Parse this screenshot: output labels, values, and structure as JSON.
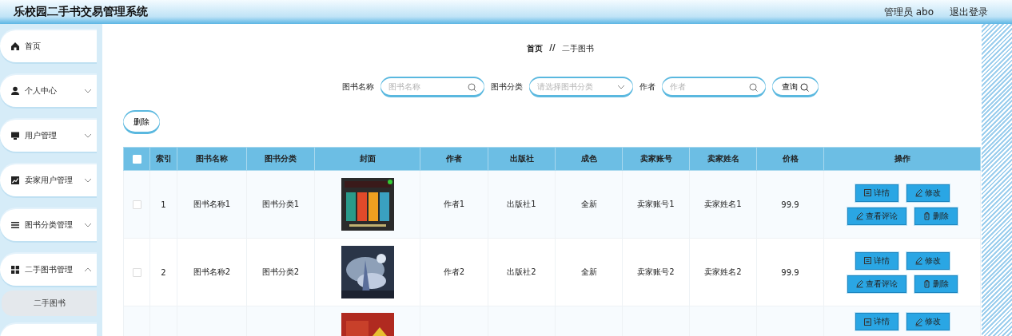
{
  "header": {
    "title": "乐校园二手书交易管理系统",
    "user": "管理员 abo",
    "logout": "退出登录"
  },
  "sidebar": {
    "items": [
      {
        "label": "首页"
      },
      {
        "label": "个人中心",
        "expanded": false
      },
      {
        "label": "用户管理",
        "expanded": false
      },
      {
        "label": "卖家用户管理",
        "expanded": false
      },
      {
        "label": "图书分类管理",
        "expanded": false
      },
      {
        "label": "二手图书管理",
        "expanded": true,
        "children": [
          {
            "label": "二手图书",
            "selected": true
          }
        ]
      }
    ]
  },
  "breadcrumb": [
    "首页",
    "二手图书"
  ],
  "breadcrumb_separator": "//",
  "search": {
    "fields": [
      {
        "label": "图书名称",
        "placeholder": "图书名称",
        "kind": "text"
      },
      {
        "label": "图书分类",
        "placeholder": "请选择图书分类",
        "kind": "select"
      },
      {
        "label": "作者",
        "placeholder": "作者",
        "kind": "text"
      }
    ],
    "button": "查询"
  },
  "delete_button": "删除",
  "table": {
    "columns": [
      "索引",
      "图书名称",
      "图书分类",
      "封面",
      "作者",
      "出版社",
      "成色",
      "卖家账号",
      "卖家姓名",
      "价格",
      "操作"
    ],
    "all_checked": false,
    "rows": [
      {
        "checked": false,
        "cells": [
          "1",
          "图书名称1",
          "图书分类1",
          "",
          "作者1",
          "出版社1",
          "全新",
          "卖家账号1",
          "卖家姓名1",
          "99.9"
        ],
        "actions": [
          "详情",
          "修改",
          "查看评论",
          "删除"
        ]
      },
      {
        "checked": false,
        "cells": [
          "2",
          "图书名称2",
          "图书分类2",
          "",
          "作者2",
          "出版社2",
          "全新",
          "卖家账号2",
          "卖家姓名2",
          "99.9"
        ],
        "actions": [
          "详情",
          "修改",
          "查看评论",
          "删除"
        ]
      },
      {
        "cells": [
          "",
          "",
          "",
          "",
          "",
          "",
          "",
          "",
          "",
          ""
        ],
        "actions": [
          "详情",
          "修改"
        ]
      }
    ]
  }
}
